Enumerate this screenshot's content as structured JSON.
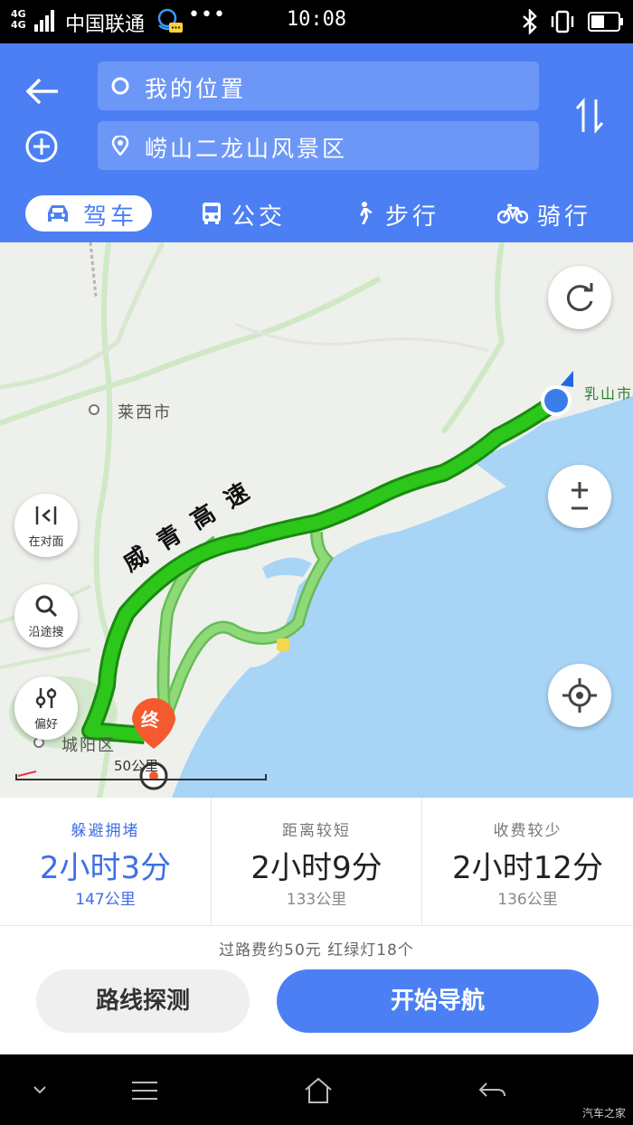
{
  "status_bar": {
    "network": "4G 4G",
    "carrier": "中国联通",
    "time": "10:08",
    "icons": [
      "signal-icon",
      "assistant-icon",
      "bluetooth-icon",
      "vibrate-icon",
      "battery-icon"
    ]
  },
  "header": {
    "from_text": "我的位置",
    "to_text": "崂山二龙山风景区",
    "modes": [
      {
        "label": "驾车",
        "icon": "car-icon",
        "active": true
      },
      {
        "label": "公交",
        "icon": "bus-icon",
        "active": false
      },
      {
        "label": "步行",
        "icon": "walk-icon",
        "active": false
      },
      {
        "label": "骑行",
        "icon": "bike-icon",
        "active": false
      }
    ],
    "colors": {
      "primary": "#4c7ff4",
      "field": "#6d97f7"
    }
  },
  "map": {
    "highway_label": "威青高速",
    "city_label": "莱西市",
    "district_label": "城阳区",
    "edge_label": "乳山市",
    "end_marker": "终",
    "scale": "50公里",
    "side_buttons": [
      "在对面",
      "沿途搜",
      "偏好"
    ],
    "colors": {
      "route_main": "#2dc61b",
      "route_alt": "#8fd978",
      "sea": "#a8d4f6"
    }
  },
  "routes": [
    {
      "tag": "躲避拥堵",
      "time": "2小时3分",
      "distance": "147公里",
      "selected": true
    },
    {
      "tag": "距离较短",
      "time": "2小时9分",
      "distance": "133公里",
      "selected": false
    },
    {
      "tag": "收费较少",
      "time": "2小时12分",
      "distance": "136公里",
      "selected": false
    }
  ],
  "toll_info": "过路费约50元 红绿灯18个",
  "buttons": {
    "probe": "路线探测",
    "start": "开始导航"
  },
  "watermark": "汽车之家"
}
